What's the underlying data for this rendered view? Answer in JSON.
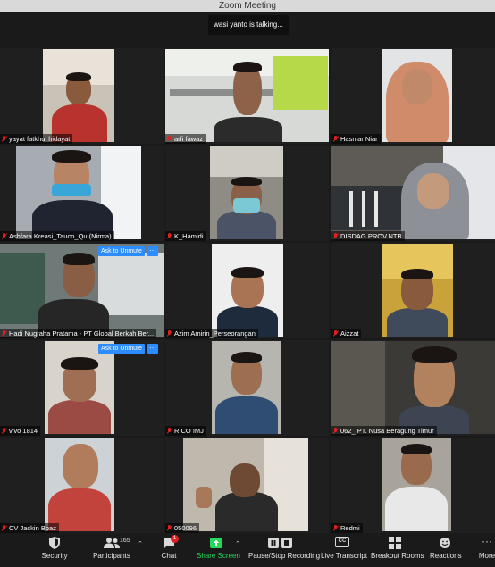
{
  "window": {
    "title": "Zoom Meeting"
  },
  "banner": {
    "talking": "wasi yanto is talking..."
  },
  "participants": [
    {
      "name": "yayat fatkhul hidayat",
      "muted": true
    },
    {
      "name": "arfi fawaz",
      "muted": true
    },
    {
      "name": "Hasniar Niar",
      "muted": true
    },
    {
      "name": "Ashfara Kreasi_Tauco_Qu (Nirma)",
      "muted": true
    },
    {
      "name": "K_Hamidi",
      "muted": true
    },
    {
      "name": "DISDAG PROV.NTB",
      "muted": true
    },
    {
      "name": "Hadi Nugraha Pratama - PT Global Berkah Ber...",
      "muted": true,
      "ask_to_unmute": "Ask to Unmute",
      "more": "···"
    },
    {
      "name": "Azim Amirin_Perseorangan",
      "muted": true
    },
    {
      "name": "Aizzat",
      "muted": true
    },
    {
      "name": "vivo 1814",
      "muted": true,
      "ask_to_unmute": "Ask to Unmute",
      "more": "···"
    },
    {
      "name": "RICO IMJ",
      "muted": true
    },
    {
      "name": "062_ PT. Nusa Beragung Timur",
      "muted": true
    },
    {
      "name": "CV Jackin Boaz",
      "muted": true
    },
    {
      "name": "050096",
      "muted": true
    },
    {
      "name": "Redmi",
      "muted": true
    }
  ],
  "toolbar": {
    "security": "Security",
    "participants": "Participants",
    "participants_count": "165",
    "chat": "Chat",
    "chat_badge": "1",
    "share_screen": "Share Screen",
    "recording": "Pause/Stop Recording",
    "live_transcript": "Live Transcript",
    "cc_icon_text": "CC",
    "breakout_rooms": "Breakout Rooms",
    "reactions": "Reactions",
    "more": "More"
  },
  "colors": {
    "accent_blue": "#2d8cff",
    "share_green": "#23d959",
    "mute_red": "#e02020"
  }
}
